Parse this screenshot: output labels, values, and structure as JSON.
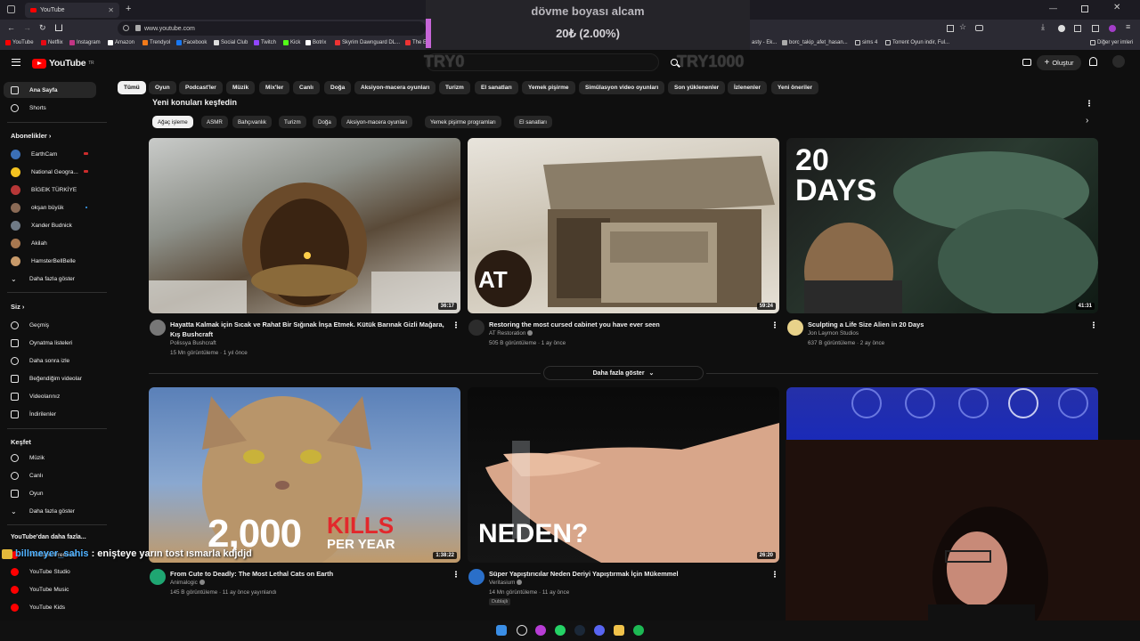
{
  "browser": {
    "tab_title": "YouTube",
    "url": "www.youtube.com",
    "bookmarks": [
      "YouTube",
      "Netflix",
      "Instagram",
      "Amazon",
      "Trendyol",
      "Facebook",
      "Social Club",
      "Twitch",
      "Kick",
      "Botrix",
      "Skyrim Dawnguard DL...",
      "The E",
      "asty - Ek...",
      "borc_takip_afet_hasan...",
      "sims 4",
      "Torrent Oyun indir, Ful...",
      "Diğer yer imleri"
    ]
  },
  "donation": {
    "title": "dövme boyası alcam",
    "amount": "20₺ (2.00%)",
    "min_label": "TRY0",
    "max_label": "TRY1000",
    "accent": "#c766d8"
  },
  "header": {
    "logo_text": "YouTube",
    "logo_country": "TR",
    "create_label": "Oluştur"
  },
  "sidebar": {
    "main": [
      {
        "label": "Ana Sayfa",
        "icon": "home-icon"
      },
      {
        "label": "Shorts",
        "icon": "shorts-icon"
      }
    ],
    "subs_header": "Abonelikler",
    "subscriptions": [
      {
        "label": "EarthCam",
        "color": "#3b6fb6"
      },
      {
        "label": "National Geogra...",
        "color": "#f3c220"
      },
      {
        "label": "BİGElK TÜRKİYE",
        "color": "#b73737"
      },
      {
        "label": "okşan büyük",
        "color": "#8a6a55"
      },
      {
        "label": "Xander Budnick",
        "color": "#6f7a86"
      },
      {
        "label": "Akilah",
        "color": "#a87850"
      },
      {
        "label": "HamsterBellBelle",
        "color": "#c89a6a"
      }
    ],
    "subs_more": "Daha fazla göster",
    "you_header": "Siz",
    "you_items": [
      {
        "label": "Geçmiş",
        "icon": "history-icon"
      },
      {
        "label": "Oynatma listeleri",
        "icon": "playlist-icon"
      },
      {
        "label": "Daha sonra izle",
        "icon": "clock-icon"
      },
      {
        "label": "Beğendiğim videolar",
        "icon": "like-icon"
      },
      {
        "label": "Videolarınız",
        "icon": "video-icon"
      },
      {
        "label": "İndirilenler",
        "icon": "download-icon"
      }
    ],
    "explore_header": "Keşfet",
    "explore_items": [
      {
        "label": "Müzik",
        "icon": "music-icon"
      },
      {
        "label": "Canlı",
        "icon": "live-icon"
      },
      {
        "label": "Oyun",
        "icon": "gaming-icon"
      }
    ],
    "explore_more": "Daha fazla göster",
    "more_header": "YouTube'dan daha fazla...",
    "more_items": [
      {
        "label": "YouTube Premium"
      },
      {
        "label": "YouTube Studio"
      },
      {
        "label": "YouTube Music"
      },
      {
        "label": "YouTube Kids"
      }
    ]
  },
  "chips": [
    "Tümü",
    "Oyun",
    "Podcast'ler",
    "Müzik",
    "Mix'ler",
    "Canlı",
    "Doğa",
    "Aksiyon-macera oyunları",
    "Turizm",
    "El sanatları",
    "Yemek pişirme",
    "Simülasyon video oyunları",
    "Son yüklenenler",
    "İzlenenler",
    "Yeni öneriler"
  ],
  "section": {
    "title": "Yeni konuları keşfedin",
    "chips": [
      "Ağaç işleme",
      "ASMR",
      "Bahçıvanlık",
      "Turizm",
      "Doğa",
      "Aksiyon-macera oyunları",
      "Yemek pişirme programları",
      "El sanatları"
    ],
    "videos": [
      {
        "title": "Hayatta Kalmak için Sıcak ve Rahat Bir Sığınak İnşa Etmek. Kütük Barınak Gizli Mağara,",
        "title2": "Kış Bushcraft",
        "channel": "Polissya Bushcraft",
        "meta": "15 Mn görüntüleme · 1 yıl önce",
        "duration": "36:17"
      },
      {
        "title": "Restoring the most cursed cabinet you have ever seen",
        "channel": "AT Restoration",
        "meta": "505 B görüntüleme · 1 ay önce",
        "duration": "59:24",
        "badge": "AT"
      },
      {
        "title": "Sculpting a Life Size Alien in 20 Days",
        "channel": "Jon Laymon Studios",
        "meta": "637 B görüntüleme · 2 ay önce",
        "duration": "41:31",
        "overlay": "20 DAYS"
      }
    ],
    "more_label": "Daha fazla göster"
  },
  "videos_row2": [
    {
      "title": "From Cute to Deadly: The Most Lethal Cats on Earth",
      "channel": "Animalogic",
      "meta": "145 B görüntüleme · 11 ay önce yayınlandı",
      "duration": "1:38:22",
      "overlay_num": "2,000",
      "overlay_kills": "KILLS",
      "overlay_per": "PER YEAR"
    },
    {
      "title": "Süper Yapıştırıcılar Neden Deriyi Yapıştırmak İçin Mükemmel",
      "channel": "Veritasium",
      "meta": "14 Mn görüntüleme · 11 ay önce",
      "duration": "26:20",
      "overlay": "NEDEN?",
      "tag": "Dublajlı"
    }
  ],
  "chat": {
    "user": "billmeyer_sahis",
    "message": ": enişteye yarın tost ısmarla kdjdjd"
  }
}
